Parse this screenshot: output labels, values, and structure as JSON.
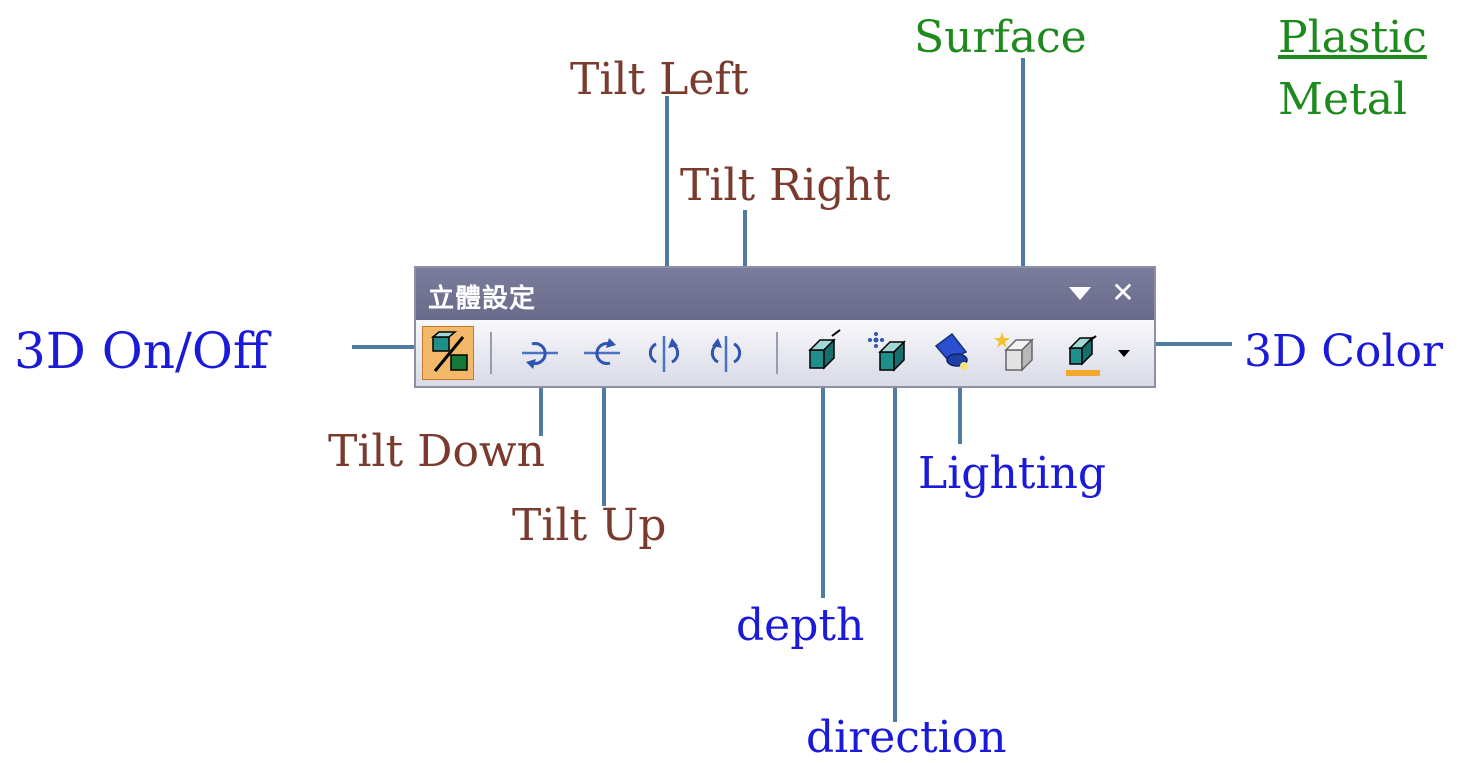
{
  "toolbar": {
    "title": "立體設定",
    "menu_icon": "dropdown-triangle-icon",
    "close_icon": "close-icon",
    "buttons": [
      {
        "id": "3d-on-off",
        "icon": "3d-toggle-icon",
        "active": true
      },
      {
        "id": "tilt-down",
        "icon": "tilt-down-icon"
      },
      {
        "id": "tilt-up",
        "icon": "tilt-up-icon"
      },
      {
        "id": "tilt-left",
        "icon": "tilt-left-icon"
      },
      {
        "id": "tilt-right",
        "icon": "tilt-right-icon"
      },
      {
        "id": "depth",
        "icon": "depth-icon"
      },
      {
        "id": "direction",
        "icon": "direction-icon"
      },
      {
        "id": "lighting",
        "icon": "lighting-icon"
      },
      {
        "id": "surface",
        "icon": "surface-icon"
      },
      {
        "id": "3d-color",
        "icon": "3d-color-icon",
        "has_dropdown": true
      }
    ]
  },
  "callouts": {
    "tilt_left": "Tilt Left",
    "tilt_right": "Tilt Right",
    "tilt_down": "Tilt Down",
    "tilt_up": "Tilt Up",
    "surface": "Surface",
    "on_off": "3D On/Off",
    "color": "3D Color",
    "lighting": "Lighting",
    "depth": "depth",
    "direction": "direction"
  },
  "surface_options": {
    "plastic": "Plastic",
    "metal": "Metal"
  },
  "colors": {
    "annotation_brown": "#7a3b2e",
    "annotation_blue": "#1a1ad8",
    "annotation_green": "#1e8a1e",
    "leader_line": "#4f7aa3",
    "titlebar": "#6e6f8f",
    "active_button": "#f4b86a"
  }
}
